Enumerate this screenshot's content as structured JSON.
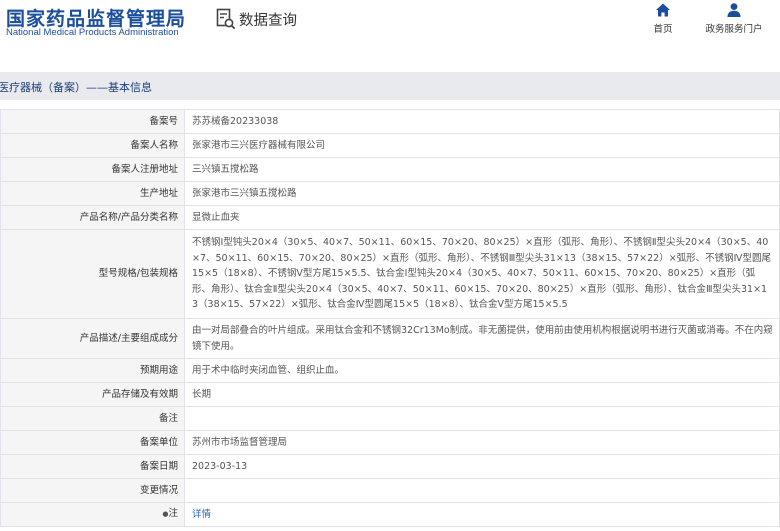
{
  "header": {
    "logo_cn": "国家药品监督管理局",
    "logo_en": "National Medical Products Administration",
    "query_title": "数据查询",
    "nav": [
      {
        "label": "首页",
        "icon": "home-icon"
      },
      {
        "label": "政务服务门户",
        "icon": "user-icon"
      }
    ]
  },
  "breadcrumb": "医疗器械（备案）——基本信息",
  "colors": {
    "brand": "#1b4f9c",
    "link": "#2a64b8",
    "label_bg": "#f5f5f5",
    "breadcrumb_bg": "#e9eaee"
  },
  "rows": [
    {
      "label": "备案号",
      "value": "苏苏械备20233038"
    },
    {
      "label": "备案人名称",
      "value": "张家港市三兴医疗器械有限公司"
    },
    {
      "label": "备案人注册地址",
      "value": "三兴镇五搅松路"
    },
    {
      "label": "生产地址",
      "value": "张家港市三兴镇五搅松路"
    },
    {
      "label": "产品名称/产品分类名称",
      "value": "显微止血夹"
    },
    {
      "label": "型号规格/包装规格",
      "value": "不锈钢Ⅰ型钝头20×4（30×5、40×7、50×11、60×15、70×20、80×25）×直形（弧形、角形）、不锈钢Ⅱ型尖头20×4（30×5、40×7、50×11、60×15、70×20、80×25）×直形（弧形、角形）、不锈钢Ⅲ型尖头31×13（38×15、57×22）×弧形、不锈钢Ⅳ型圆尾15×5（18×8）、不锈钢Ⅴ型方尾15×5.5、钛合金Ⅰ型钝头20×4（30×5、40×7、50×11、60×15、70×20、80×25）×直形（弧形、角形）、钛合金Ⅱ型尖头20×4（30×5、40×7、50×11、60×15、70×20、80×25）×直形（弧形、角形）、钛合金Ⅲ型尖头31×13（38×15、57×22）×弧形、钛合金Ⅳ型圆尾15×5（18×8）、钛合金Ⅴ型方尾15×5.5"
    },
    {
      "label": "产品描述/主要组成成分",
      "value": "由一对局部叠合的叶片组成。采用钛合金和不锈钢32Cr13Mo制成。非无菌提供，使用前由使用机构根据说明书进行灭菌或消毒。不在内窥镜下使用。"
    },
    {
      "label": "预期用途",
      "value": "用于术中临时夹闭血管、组织止血。"
    },
    {
      "label": "产品存储及有效期",
      "value": "长期"
    },
    {
      "label": "备注",
      "value": ""
    },
    {
      "label": "备案单位",
      "value": "苏州市市场监督管理局"
    },
    {
      "label": "备案日期",
      "value": "2023-03-13"
    },
    {
      "label": "变更情况",
      "value": ""
    }
  ],
  "note_row": {
    "star": "●",
    "label": "注",
    "link": "详情"
  }
}
